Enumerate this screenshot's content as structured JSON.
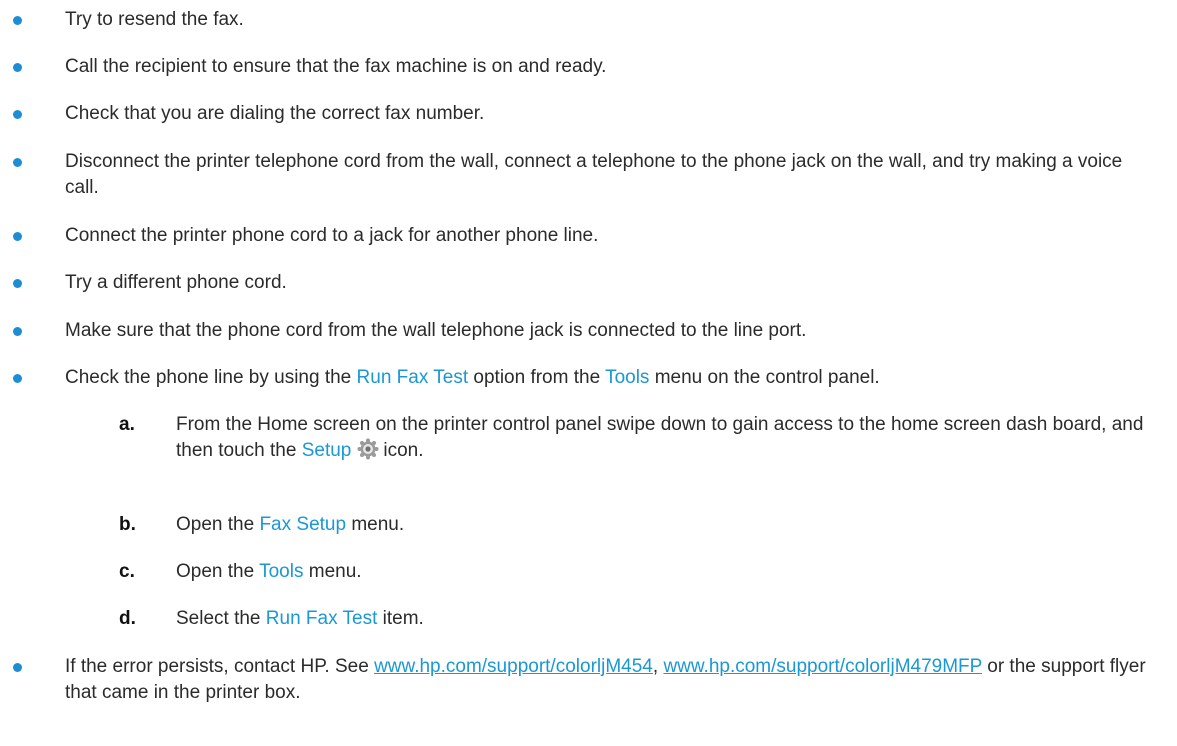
{
  "bullets": [
    {
      "text": "Try to resend the fax."
    },
    {
      "text": "Call the recipient to ensure that the fax machine is on and ready."
    },
    {
      "text": "Check that you are dialing the correct fax number."
    },
    {
      "text": "Disconnect the printer telephone cord from the wall, connect a telephone to the phone jack on the wall, and try making a voice call."
    },
    {
      "text": "Connect the printer phone cord to a jack for another phone line."
    },
    {
      "text": "Try a different phone cord."
    },
    {
      "text": "Make sure that the phone cord from the wall telephone jack is connected to the line port."
    }
  ],
  "check_line": {
    "before": "Check the phone line by using the ",
    "hl1": "Run Fax Test",
    "middle": " option from the ",
    "hl2": "Tools",
    "after": " menu on the control panel."
  },
  "steps": [
    {
      "letter": "a.",
      "before": "From the Home screen on the printer control panel swipe down to gain access to the home screen dash board, and then touch the ",
      "hl": "Setup",
      "after": "icon.",
      "icon": "gear-icon"
    },
    {
      "letter": "b.",
      "before": "Open the ",
      "hl": "Fax Setup",
      "after": " menu."
    },
    {
      "letter": "c.",
      "before": "Open the ",
      "hl": "Tools",
      "after": " menu."
    },
    {
      "letter": "d.",
      "before": "Select the ",
      "hl": "Run Fax Test",
      "after": " item."
    }
  ],
  "last_bullet": {
    "before": "If the error persists, contact HP. See ",
    "link1": "www.hp.com/support/colorljM454",
    "sep": ", ",
    "link2": "www.hp.com/support/colorljM479MFP",
    "after": " or the support flyer that came in the printer box."
  },
  "colors": {
    "accent": "#1a98d4",
    "bullet": "#1f8dd6",
    "text": "#2b2b2b"
  }
}
